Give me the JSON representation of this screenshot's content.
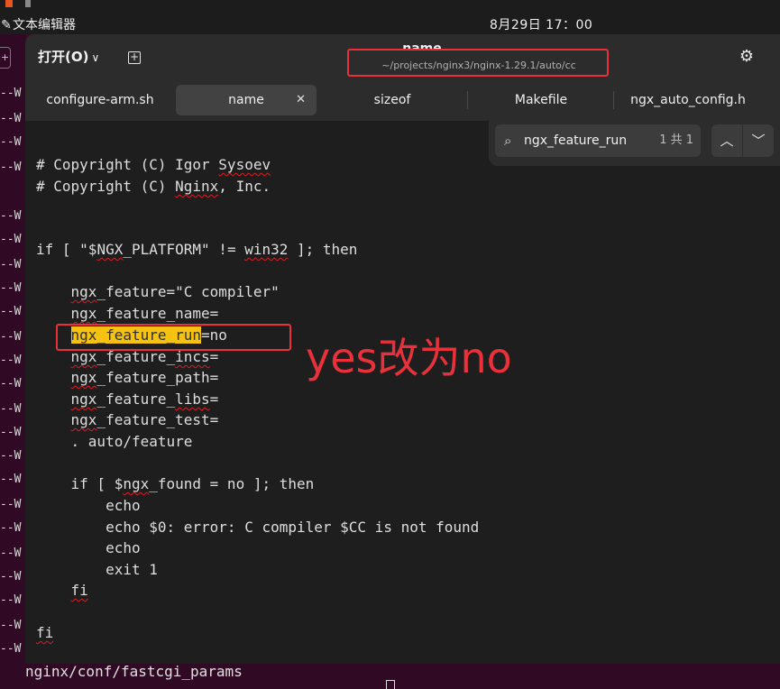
{
  "system_bar": {
    "app_icon": "text-editor-icon",
    "app_name": "文本编辑器",
    "clock": "8月29日  17：00"
  },
  "terminal": {
    "left_column_text": [
      "--W",
      "--W",
      "--W",
      "--W",
      "--W",
      "--W",
      "--W",
      "--W",
      "--W",
      "--W",
      "--W",
      "--W",
      "--W",
      "--W",
      "--W",
      "--W",
      "--W",
      "--W",
      "--W",
      "--W",
      "--W",
      "--W",
      "--W",
      "--W",
      "--W"
    ],
    "bottom_line": "nginx/conf/fastcgi_params",
    "left_new_tab_icon": "plus-icon"
  },
  "editor": {
    "open_button_label": "打开(O)",
    "title": "name",
    "path": "~/projects/nginx3/nginx-1.29.1/auto/cc",
    "tabs": [
      {
        "label": "configure-arm.sh",
        "active": false
      },
      {
        "label": "name",
        "active": true
      },
      {
        "label": "sizeof",
        "active": false
      },
      {
        "label": "Makefile",
        "active": false
      },
      {
        "label": "ngx_auto_config.h",
        "active": false
      }
    ],
    "search": {
      "query": "ngx_feature_run",
      "match_count": "1 共 1"
    },
    "code_lines": {
      "l1": "# Copyright (C) Igor Sysoev",
      "l2": "# Copyright (C) Nginx, Inc.",
      "l3": "if [ \"$NGX_PLATFORM\" != win32 ]; then",
      "l4": "    ngx_feature=\"C compiler\"",
      "l5": "    ngx_feature_name=",
      "l6_match": "ngx_feature_run",
      "l6_rest": "=no",
      "l7": "    ngx_feature_incs=",
      "l8": "    ngx_feature_path=",
      "l9": "    ngx_feature_libs=",
      "l10": "    ngx_feature_test=",
      "l11": "    . auto/feature",
      "l12": "    if [ $ngx_found = no ]; then",
      "l13": "        echo",
      "l14": "        echo $0: error: C compiler $CC is not found",
      "l15": "        echo",
      "l16": "        exit 1",
      "l17": "    fi",
      "l18": "fi"
    }
  },
  "annotation": {
    "text": "yes改为no",
    "color": "#e8313b"
  }
}
